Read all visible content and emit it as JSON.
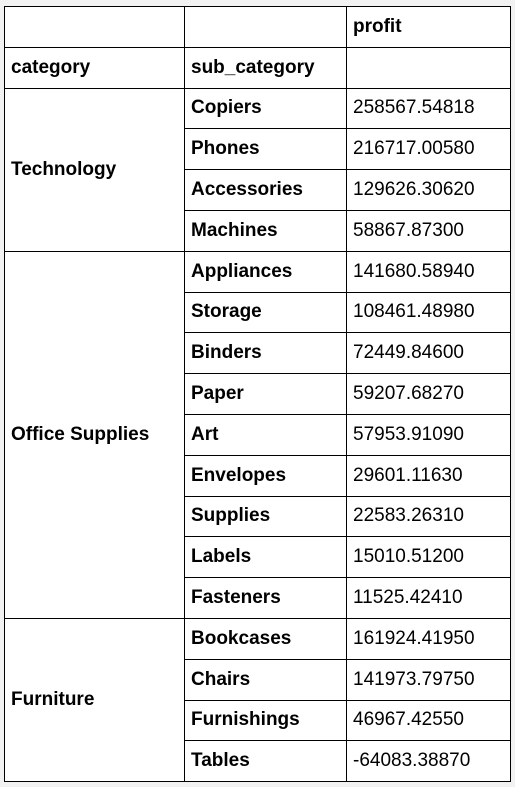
{
  "header": {
    "value_column": "profit",
    "index_level_1": "category",
    "index_level_2": "sub_category"
  },
  "groups": [
    {
      "category": "Technology",
      "rows": [
        {
          "sub_category": "Copiers",
          "profit": "258567.54818"
        },
        {
          "sub_category": "Phones",
          "profit": "216717.00580"
        },
        {
          "sub_category": "Accessories",
          "profit": "129626.30620"
        },
        {
          "sub_category": "Machines",
          "profit": "58867.87300"
        }
      ]
    },
    {
      "category": "Office Supplies",
      "rows": [
        {
          "sub_category": "Appliances",
          "profit": "141680.58940"
        },
        {
          "sub_category": "Storage",
          "profit": "108461.48980"
        },
        {
          "sub_category": "Binders",
          "profit": "72449.84600"
        },
        {
          "sub_category": "Paper",
          "profit": "59207.68270"
        },
        {
          "sub_category": "Art",
          "profit": "57953.91090"
        },
        {
          "sub_category": "Envelopes",
          "profit": "29601.11630"
        },
        {
          "sub_category": "Supplies",
          "profit": "22583.26310"
        },
        {
          "sub_category": "Labels",
          "profit": "15010.51200"
        },
        {
          "sub_category": "Fasteners",
          "profit": "11525.42410"
        }
      ]
    },
    {
      "category": "Furniture",
      "rows": [
        {
          "sub_category": "Bookcases",
          "profit": "161924.41950"
        },
        {
          "sub_category": "Chairs",
          "profit": "141973.79750"
        },
        {
          "sub_category": "Furnishings",
          "profit": "46967.42550"
        },
        {
          "sub_category": "Tables",
          "profit": "-64083.38870"
        }
      ]
    }
  ]
}
